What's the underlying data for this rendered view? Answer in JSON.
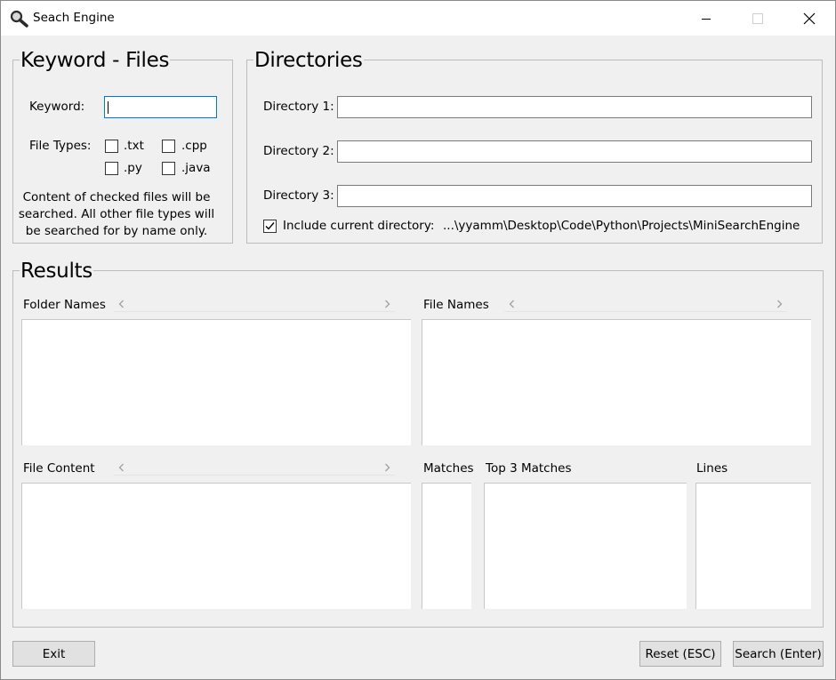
{
  "window": {
    "title": "Seach Engine",
    "icons": {
      "app": "magnifier-icon",
      "minimize": "minimize-icon",
      "maximize": "maximize-icon",
      "close": "close-icon"
    }
  },
  "keyword_files": {
    "title": "Keyword - Files",
    "keyword_label": "Keyword:",
    "keyword_value": "",
    "file_types_label": "File Types:",
    "file_types": [
      {
        "label": ".txt",
        "checked": false
      },
      {
        "label": ".cpp",
        "checked": false
      },
      {
        "label": ".py",
        "checked": false
      },
      {
        "label": ".java",
        "checked": false
      }
    ],
    "note": "Content of checked files will be searched. All other file types will be searched for by name only."
  },
  "directories": {
    "title": "Directories",
    "fields": [
      {
        "label": "Directory 1:",
        "value": ""
      },
      {
        "label": "Directory 2:",
        "value": ""
      },
      {
        "label": "Directory 3:",
        "value": ""
      }
    ],
    "include_current_label": "Include current directory:",
    "include_current_checked": true,
    "current_path": "...\\yyamm\\Desktop\\Code\\Python\\Projects\\MiniSearchEngine"
  },
  "results": {
    "title": "Results",
    "folder_names_label": "Folder Names",
    "file_names_label": "File Names",
    "file_content_label": "File Content",
    "matches_label": "Matches",
    "top3_label": "Top 3 Matches",
    "lines_label": "Lines"
  },
  "buttons": {
    "exit": "Exit",
    "reset": "Reset (ESC)",
    "search": "Search (Enter)"
  },
  "colors": {
    "window_bg": "#f0f0f0",
    "focus_border": "#0078d7",
    "button_bg": "#e1e1e1"
  }
}
